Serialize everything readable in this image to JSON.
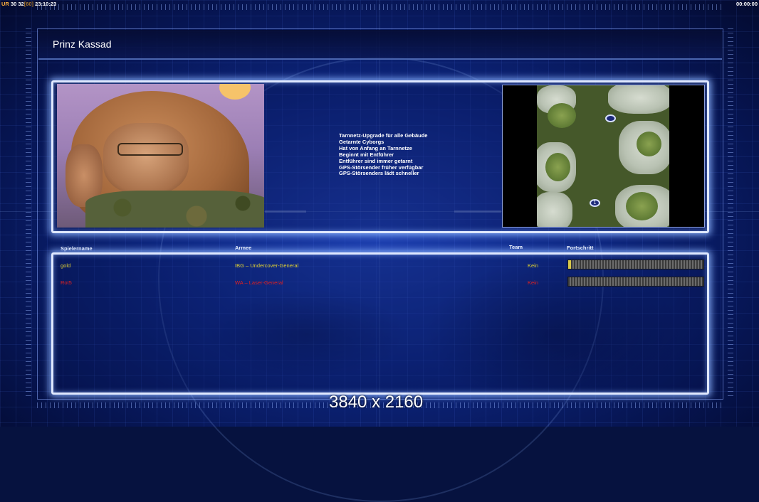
{
  "hud": {
    "tag": "UR",
    "fps_a": "30",
    "fps_b": "32",
    "fps_c": "[60]",
    "clock": "23:10:23",
    "timer": "00:00:00"
  },
  "title": "Prinz Kassad",
  "general_features": [
    "Tarnnetz-Upgrade für alle Gebäude",
    "Getarnte Cyborgs",
    "Hat von Anfang an Tarnnetze",
    "Beginnt mit Entführer",
    "Entführer sind immer getarnt",
    "GPS-Störsender früher verfügbar",
    "GPS-Störsenders lädt schneller"
  ],
  "map": {
    "spawns": [
      "",
      "1"
    ]
  },
  "table": {
    "headers": {
      "player": "Spielername",
      "army": "Armee",
      "team": "Team",
      "progress": "Fortschritt"
    },
    "rows": [
      {
        "name": "gold",
        "army": "IBG – Undercover-General",
        "team": "Kein",
        "color": "#e0d030",
        "progress": 0.02
      },
      {
        "name": "Rot5",
        "army": "WA – Laser-General",
        "team": "Kein",
        "color": "#e02020",
        "progress": 0
      }
    ]
  },
  "footer": {
    "resolution": "3840 x 2160"
  },
  "colors": {
    "panel_glow": "#dfe8ff",
    "background": "#06123f"
  }
}
